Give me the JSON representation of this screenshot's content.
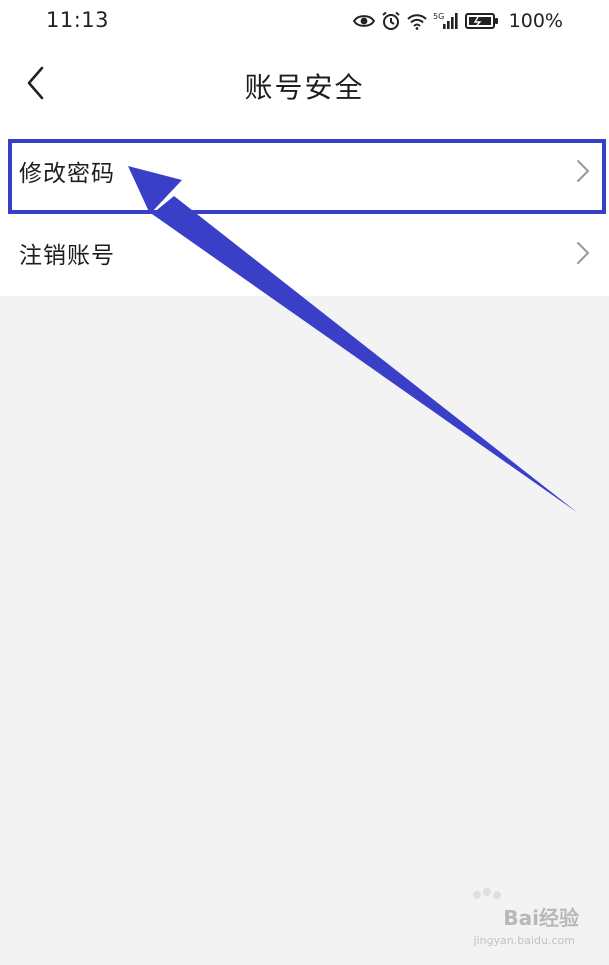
{
  "status_bar": {
    "time": "11:13",
    "battery_percent": "100%",
    "icons": [
      "eye-icon",
      "alarm-icon",
      "wifi-icon",
      "signal-5g-icon",
      "battery-icon"
    ]
  },
  "nav": {
    "title": "账号安全",
    "back_icon": "chevron-left-icon"
  },
  "menu": {
    "items": [
      {
        "label": "修改密码",
        "icon": "chevron-right-icon"
      },
      {
        "label": "注销账号",
        "icon": "chevron-right-icon"
      }
    ]
  },
  "annotation": {
    "color": "#3a3fc8"
  },
  "watermark": {
    "text": "Bai经验",
    "sub": "jingyan.baidu.com"
  },
  "colors": {
    "background": "#f3f3f3",
    "surface": "#ffffff",
    "text": "#1e1e1e",
    "chevron": "#9a9a9a"
  }
}
